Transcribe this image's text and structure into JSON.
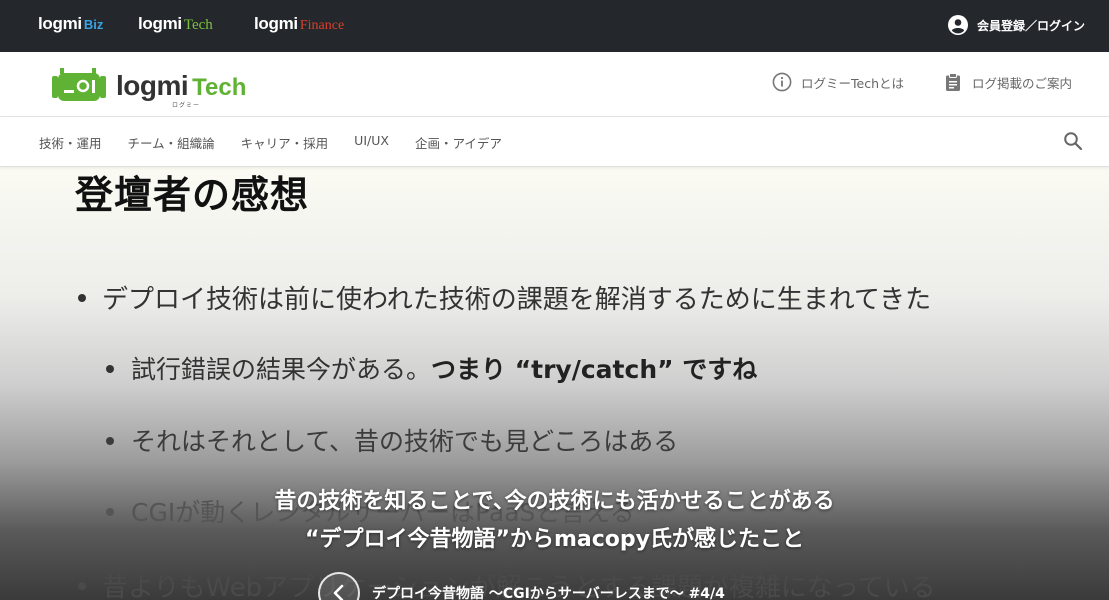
{
  "network": {
    "items": [
      {
        "name": "logmi",
        "suffix": "Biz"
      },
      {
        "name": "logmi",
        "suffix": "Tech"
      },
      {
        "name": "logmi",
        "suffix": "Finance"
      }
    ],
    "login_label": "会員登録／ログイン"
  },
  "header": {
    "brand_word": "logmi",
    "brand_suffix": "Tech",
    "brand_kana": "ログミー",
    "about_label": "ログミーTechとは",
    "ad_label": "ログ掲載のご案内"
  },
  "nav": {
    "categories": [
      "技術・運用",
      "チーム・組織論",
      "キャリア・採用",
      "UI/UX",
      "企画・アイデア"
    ]
  },
  "slide": {
    "title": "登壇者の感想",
    "bullets": [
      {
        "text": "デプロイ技術は前に使われた技術の課題を解消するために生まれてきた"
      },
      {
        "text": "試行錯誤の結果今がある。",
        "emphasis": "つまり “try/catch” ですね"
      },
      {
        "text": "それはそれとして、昔の技術でも見どころはある"
      },
      {
        "text": "CGIが動くレンタルサーバーはPaaSと言える"
      },
      {
        "text": "昔よりもWebアプリケーションが解こうとする課題が複雑になっている"
      }
    ]
  },
  "caption": {
    "line1": "昔の技術を知ることで､今の技術にも活かせることがある",
    "line2": "“デプロイ今昔物語”からmacopy氏が感じたこと"
  },
  "series": {
    "title": "デプロイ今昔物語 〜CGIからサーバーレスまで〜 #4/4"
  },
  "colors": {
    "topbar": "#24272b",
    "biz": "#3aa3e3",
    "tech": "#7ec242",
    "finance": "#d9402c",
    "brand_green": "#5fb233"
  }
}
